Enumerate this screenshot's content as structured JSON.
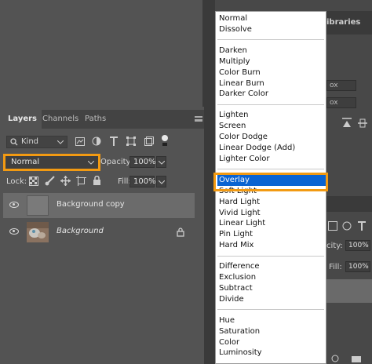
{
  "layers_panel": {
    "tabs": [
      "Layers",
      "Channels",
      "Paths"
    ],
    "active_tab": "Layers",
    "filter": {
      "label": "Kind"
    },
    "blend_mode": "Normal",
    "opacity_label": "Opacity:",
    "opacity_value": "100%",
    "lock_label": "Lock:",
    "fill_label": "Fill:",
    "fill_value": "100%",
    "layers": [
      {
        "name": "Background copy",
        "selected": true,
        "visible": true
      },
      {
        "name": "Background",
        "selected": false,
        "visible": true,
        "locked": true
      }
    ]
  },
  "right_panel": {
    "header_partial": "ibraries",
    "partial_values": [
      "ox",
      "ox",
      "city:",
      "100%",
      "Fill:",
      "100%"
    ]
  },
  "blend_menu": {
    "highlighted": "Overlay",
    "groups": [
      [
        "Normal",
        "Dissolve"
      ],
      [
        "Darken",
        "Multiply",
        "Color Burn",
        "Linear Burn",
        "Darker Color"
      ],
      [
        "Lighten",
        "Screen",
        "Color Dodge",
        "Linear Dodge (Add)",
        "Lighter Color"
      ],
      [
        "Overlay",
        "Soft Light",
        "Hard Light",
        "Vivid Light",
        "Linear Light",
        "Pin Light",
        "Hard Mix"
      ],
      [
        "Difference",
        "Exclusion",
        "Subtract",
        "Divide"
      ],
      [
        "Hue",
        "Saturation",
        "Color",
        "Luminosity"
      ]
    ],
    "overlay_partial_label": "Soft Light"
  },
  "colors": {
    "panel_bg": "#535353",
    "selected_layer": "#6b6b6b",
    "highlight_outline": "#f29a12",
    "menu_highlight": "#0a64d2"
  }
}
